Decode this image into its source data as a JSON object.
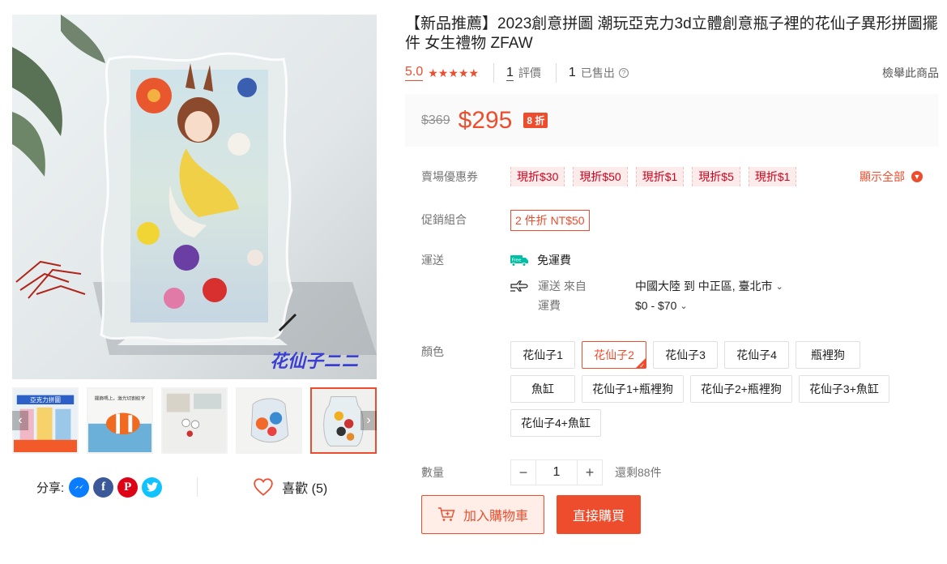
{
  "product": {
    "title": "【新品推薦】2023創意拼圖 潮玩亞克力3d立體創意瓶子裡的花仙子異形拼圖擺件 女生禮物 ZFAW",
    "rating": "5.0",
    "stars": "★★★★★",
    "reviews_count": "1",
    "reviews_label": "評價",
    "sold_count": "1",
    "sold_label": "已售出",
    "help_icon": "?",
    "report_label": "檢舉此商品"
  },
  "price": {
    "original": "$369",
    "current": "$295",
    "discount": "8 折"
  },
  "vouchers": {
    "label": "賣場優惠券",
    "items": [
      "現折$30",
      "現折$50",
      "現折$1",
      "現折$5",
      "現折$1"
    ],
    "show_all": "顯示全部",
    "show_all_icon": "chevron-down-icon"
  },
  "combo": {
    "label": "促銷組合",
    "tag": "2 件折 NT$50"
  },
  "shipping": {
    "label": "運送",
    "free_badge": "Free",
    "free_label": "免運費",
    "from_label": "運送 來自",
    "from_value": "中國大陸 到 中正區, 臺北市",
    "fee_label": "運費",
    "fee_value": "$0 - $70",
    "chevron": "⌄"
  },
  "variations": {
    "label": "顏色",
    "options": [
      "花仙子1",
      "花仙子2",
      "花仙子3",
      "花仙子4",
      "瓶裡狗",
      "魚缸",
      "花仙子1+瓶裡狗",
      "花仙子2+瓶裡狗",
      "花仙子3+魚缸",
      "花仙子4+魚缸"
    ],
    "selected_index": 1
  },
  "quantity": {
    "label": "數量",
    "value": "1",
    "minus": "−",
    "plus": "+",
    "stock": "還剩88件"
  },
  "actions": {
    "add_to_cart": "加入購物車",
    "buy_now": "直接購買"
  },
  "share": {
    "label": "分享:",
    "like_label": "喜歡 (5)"
  },
  "gallery": {
    "watermark": "花仙子ニニ",
    "thumb_arrow_left": "‹",
    "thumb_arrow_right": "›",
    "thumb1_text": "亞克力拼圖",
    "thumb2_text": "擺飾嗎上。激光切割紋字"
  },
  "colors": {
    "accent": "#ee4d2d",
    "voucher_bg": "#fbebeb"
  }
}
